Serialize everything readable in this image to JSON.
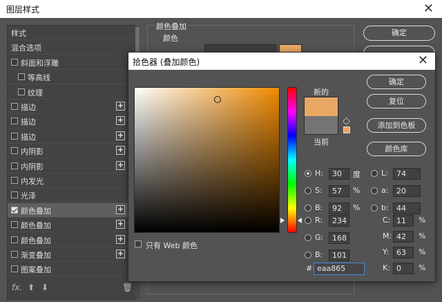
{
  "layer_style": {
    "title": "图层样式",
    "close_glyph": "✕",
    "list_items": [
      {
        "label": "样式",
        "checkbox": false,
        "checked": false,
        "plus": false,
        "indent": 0
      },
      {
        "label": "混合选项",
        "checkbox": false,
        "checked": false,
        "plus": false,
        "indent": 0
      },
      {
        "label": "斜面和浮雕",
        "checkbox": true,
        "checked": false,
        "plus": false,
        "indent": 0
      },
      {
        "label": "等高线",
        "checkbox": true,
        "checked": false,
        "plus": false,
        "indent": 1
      },
      {
        "label": "纹理",
        "checkbox": true,
        "checked": false,
        "plus": false,
        "indent": 1
      },
      {
        "label": "描边",
        "checkbox": true,
        "checked": false,
        "plus": true,
        "indent": 0
      },
      {
        "label": "描边",
        "checkbox": true,
        "checked": false,
        "plus": true,
        "indent": 0
      },
      {
        "label": "描边",
        "checkbox": true,
        "checked": false,
        "plus": true,
        "indent": 0
      },
      {
        "label": "内阴影",
        "checkbox": true,
        "checked": false,
        "plus": true,
        "indent": 0
      },
      {
        "label": "内阴影",
        "checkbox": true,
        "checked": false,
        "plus": true,
        "indent": 0
      },
      {
        "label": "内发光",
        "checkbox": true,
        "checked": false,
        "plus": false,
        "indent": 0
      },
      {
        "label": "光泽",
        "checkbox": true,
        "checked": false,
        "plus": false,
        "indent": 0
      },
      {
        "label": "颜色叠加",
        "checkbox": true,
        "checked": true,
        "plus": true,
        "indent": 0,
        "active": true
      },
      {
        "label": "颜色叠加",
        "checkbox": true,
        "checked": false,
        "plus": true,
        "indent": 0
      },
      {
        "label": "颜色叠加",
        "checkbox": true,
        "checked": false,
        "plus": true,
        "indent": 0
      },
      {
        "label": "渐变叠加",
        "checkbox": true,
        "checked": false,
        "plus": true,
        "indent": 0
      },
      {
        "label": "图案叠加",
        "checkbox": true,
        "checked": false,
        "plus": false,
        "indent": 0
      }
    ],
    "footer": {
      "fx": "fx.",
      "up": "⬆",
      "down": "⬇",
      "trash": "🗑"
    },
    "section_title": "颜色叠加",
    "section_sub": "颜色",
    "overlay_color": "#eaa865",
    "ok_label": "确定",
    "btn2_label": "",
    "btn3_label": ""
  },
  "color_picker": {
    "title": "拾色器 (叠加颜色)",
    "close_glyph": "✕",
    "new_label": "新的",
    "current_label": "当前",
    "new_color": "#eaa865",
    "current_color": "#747474",
    "buttons": {
      "ok": "确定",
      "reset": "复位",
      "add_swatch": "添加到色板",
      "libraries": "颜色库"
    },
    "web_only_label": "只有 Web 颜色",
    "hsb": [
      {
        "label": "H:",
        "value": "30",
        "unit": "度",
        "selected": true
      },
      {
        "label": "S:",
        "value": "57",
        "unit": "%",
        "selected": false
      },
      {
        "label": "B:",
        "value": "92",
        "unit": "%",
        "selected": false
      }
    ],
    "rgb": [
      {
        "label": "R:",
        "value": "234"
      },
      {
        "label": "G:",
        "value": "168"
      },
      {
        "label": "B:",
        "value": "101"
      }
    ],
    "lab": [
      {
        "label": "L:",
        "value": "74"
      },
      {
        "label": "a:",
        "value": "20"
      },
      {
        "label": "b:",
        "value": "44"
      }
    ],
    "cmyk": [
      {
        "label": "C:",
        "value": "11",
        "unit": "%"
      },
      {
        "label": "M:",
        "value": "42",
        "unit": "%"
      },
      {
        "label": "Y:",
        "value": "63",
        "unit": "%"
      },
      {
        "label": "K:",
        "value": "0",
        "unit": "%"
      }
    ],
    "hex_label": "#",
    "hex_value": "eaa865",
    "sv_saturation": 0.57,
    "sv_brightness": 0.92,
    "hue_fraction": 0.083
  }
}
